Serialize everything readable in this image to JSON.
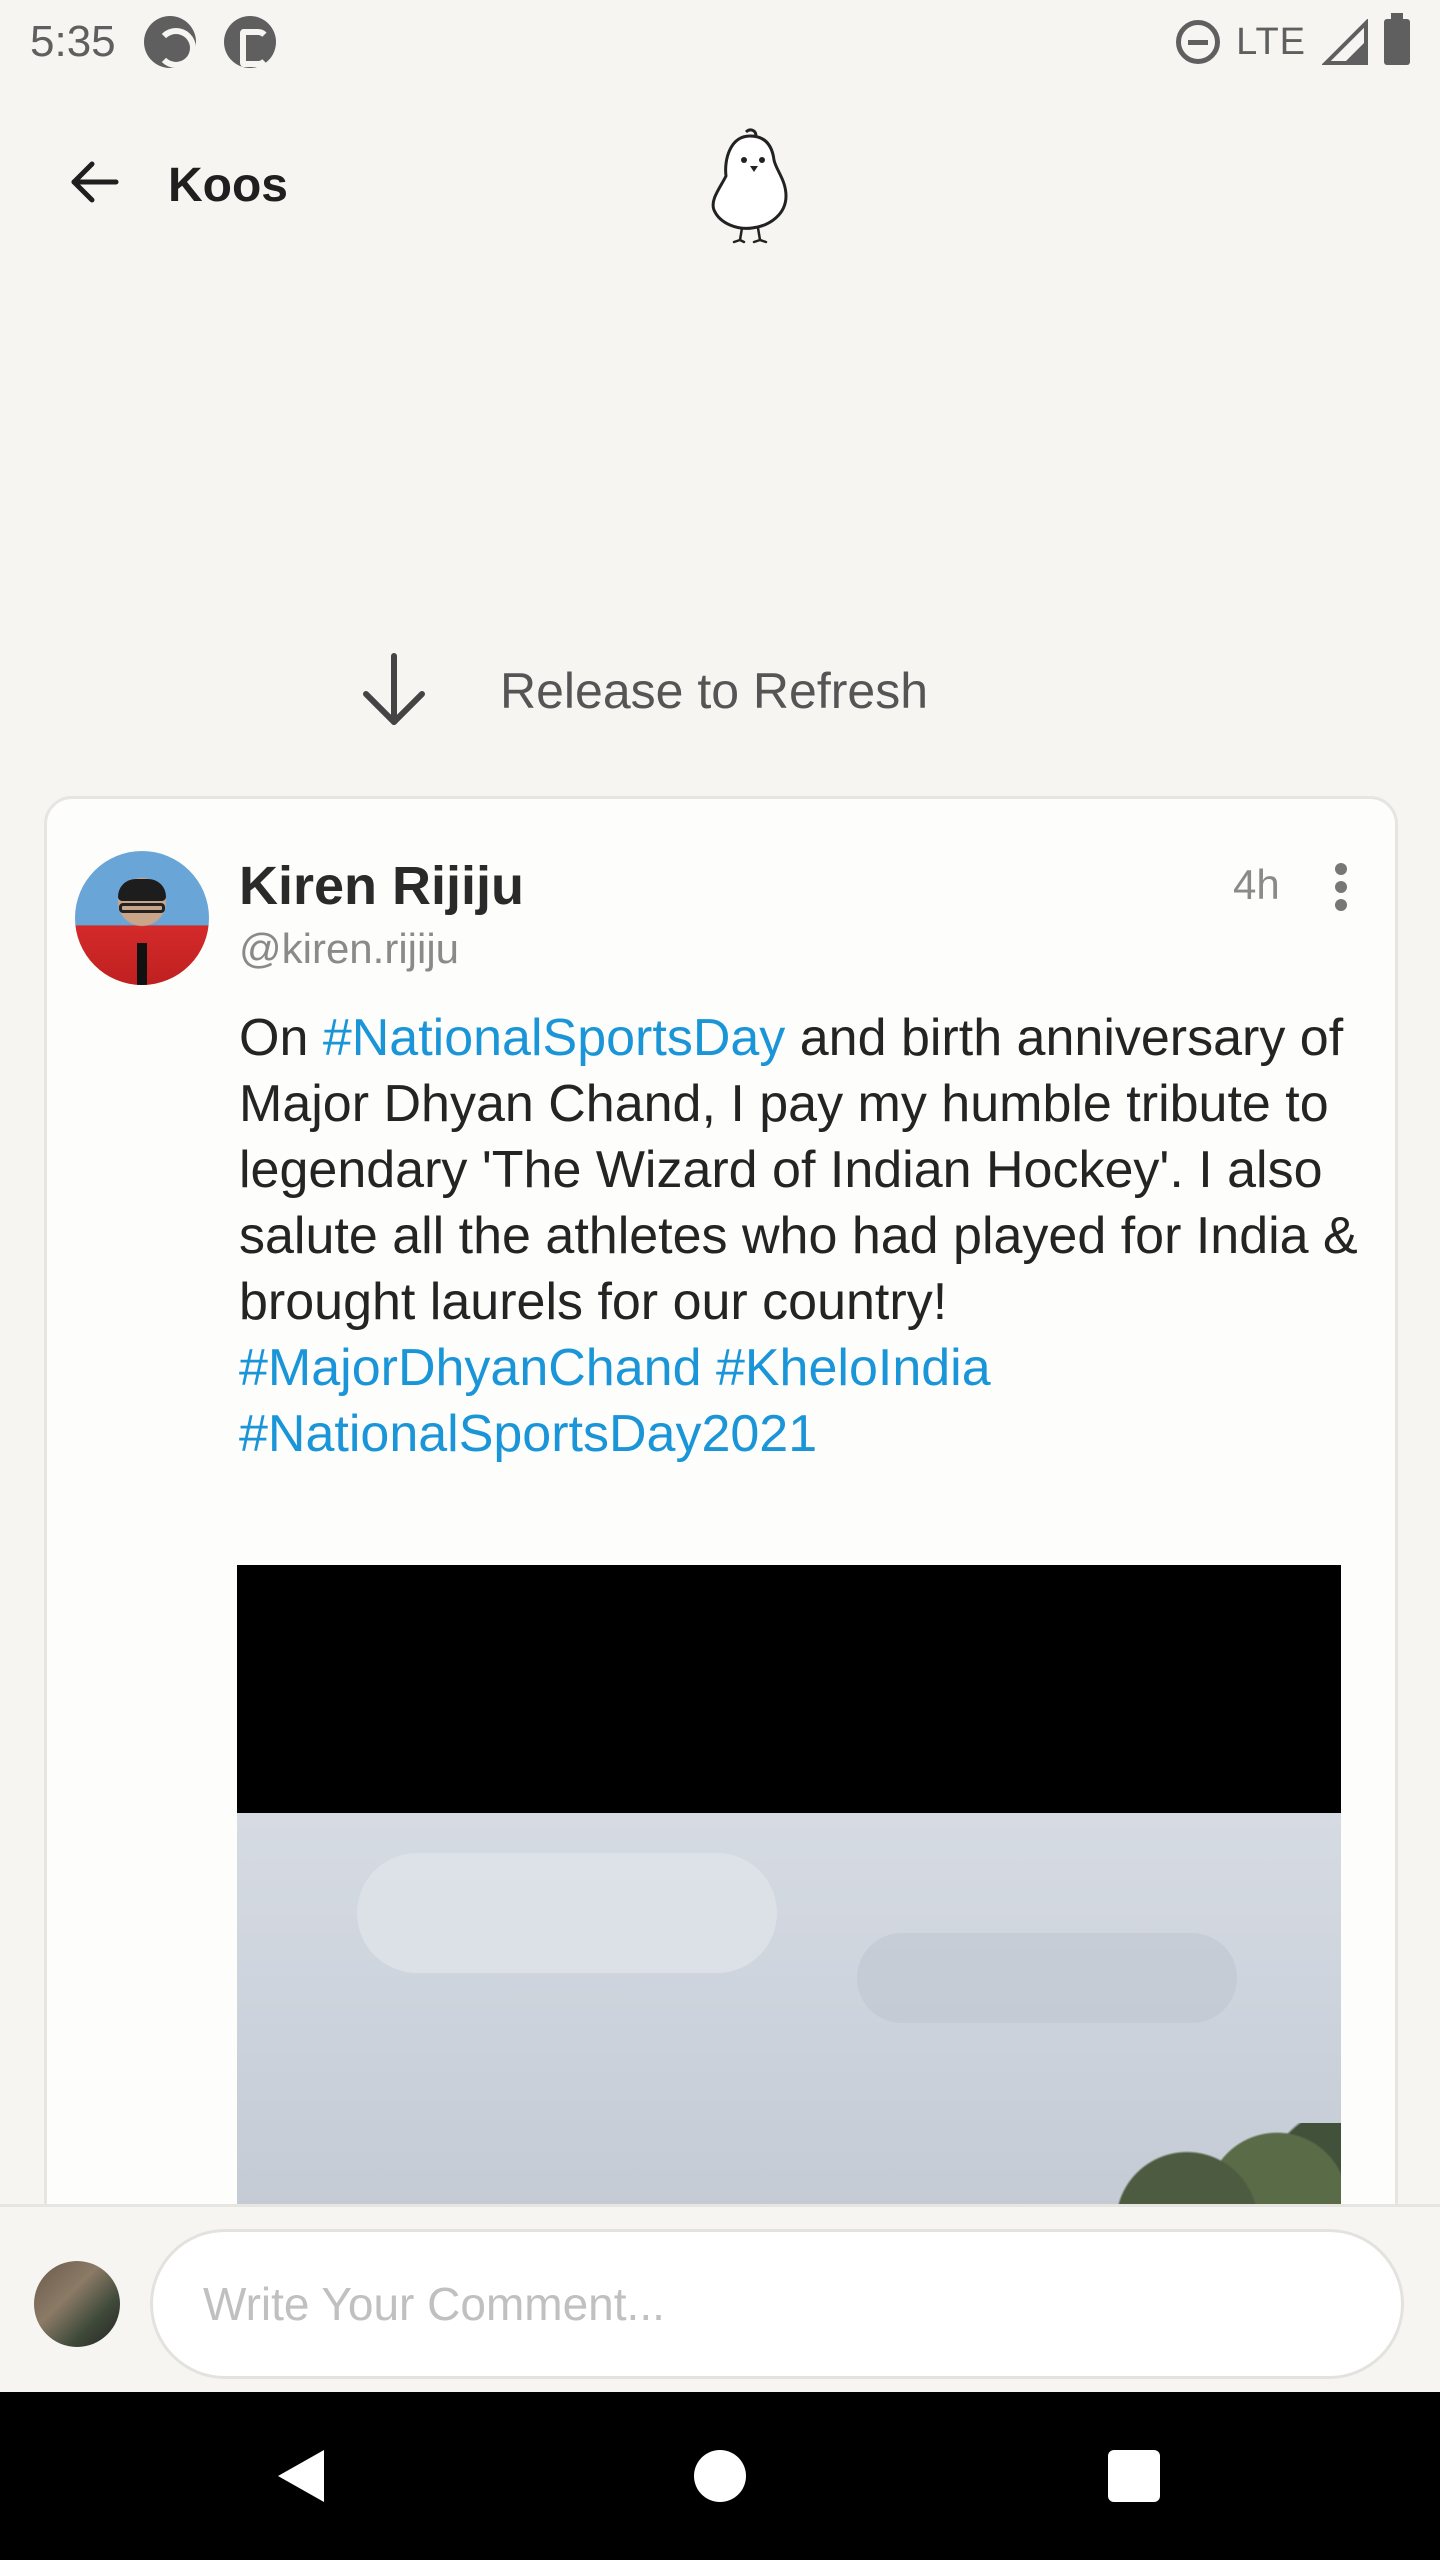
{
  "status_bar": {
    "time": "5:35",
    "network": "LTE",
    "icons": [
      "sync-app-icon",
      "koo-app-icon",
      "do-not-disturb-icon",
      "signal-icon",
      "battery-icon"
    ]
  },
  "app_bar": {
    "title": "Koos",
    "back_icon": "arrow-left-icon",
    "logo_icon": "koo-bird-logo-icon"
  },
  "refresh": {
    "label": "Release to Refresh",
    "icon": "arrow-down-icon"
  },
  "post": {
    "author_name": "Kiren Rijiju",
    "author_handle": "@kiren.rijiju",
    "time_ago": "4h",
    "body": {
      "segment_1": "On ",
      "hashtag_1": "#NationalSportsDay",
      "segment_2": "  and birth anniversary of Major Dhyan Chand, I pay my humble tribute to legendary 'The Wizard of Indian Hockey'. I also salute all the athletes who had played for India & brought laurels for our country!",
      "hashtag_2": "#MajorDhyanChand",
      "hashtag_3": "#KheloIndia",
      "hashtag_4": "#NationalSportsDay2021"
    },
    "hashtag_color": "#1a95d8"
  },
  "comment": {
    "placeholder": "Write Your Comment..."
  },
  "nav_bar": {
    "icons": [
      "nav-back-icon",
      "nav-home-icon",
      "nav-recents-icon"
    ]
  }
}
